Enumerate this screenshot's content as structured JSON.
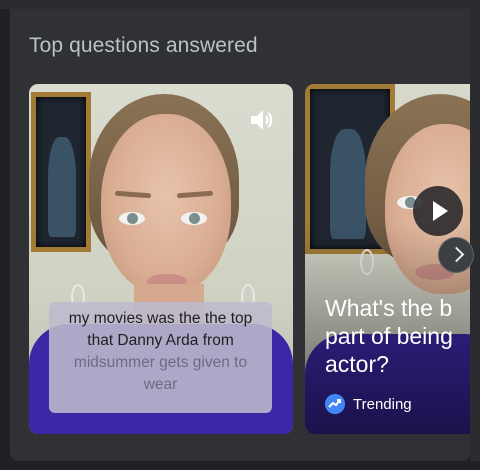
{
  "section": {
    "title": "Top questions answered"
  },
  "cards": [
    {
      "caption_main": "my movies was the the top that Danny Arda from",
      "caption_faded": "midsummer gets given to wear"
    },
    {
      "question": "What's the b\npart of being\nactor?",
      "badge": "Trending"
    }
  ],
  "icons": [
    "sound-icon",
    "play-icon",
    "trending-icon",
    "chevron-right-icon"
  ],
  "colors": {
    "background": "#202124",
    "panel": "#303134",
    "shirt": "#3c28a6",
    "trending": "#4285f4"
  }
}
